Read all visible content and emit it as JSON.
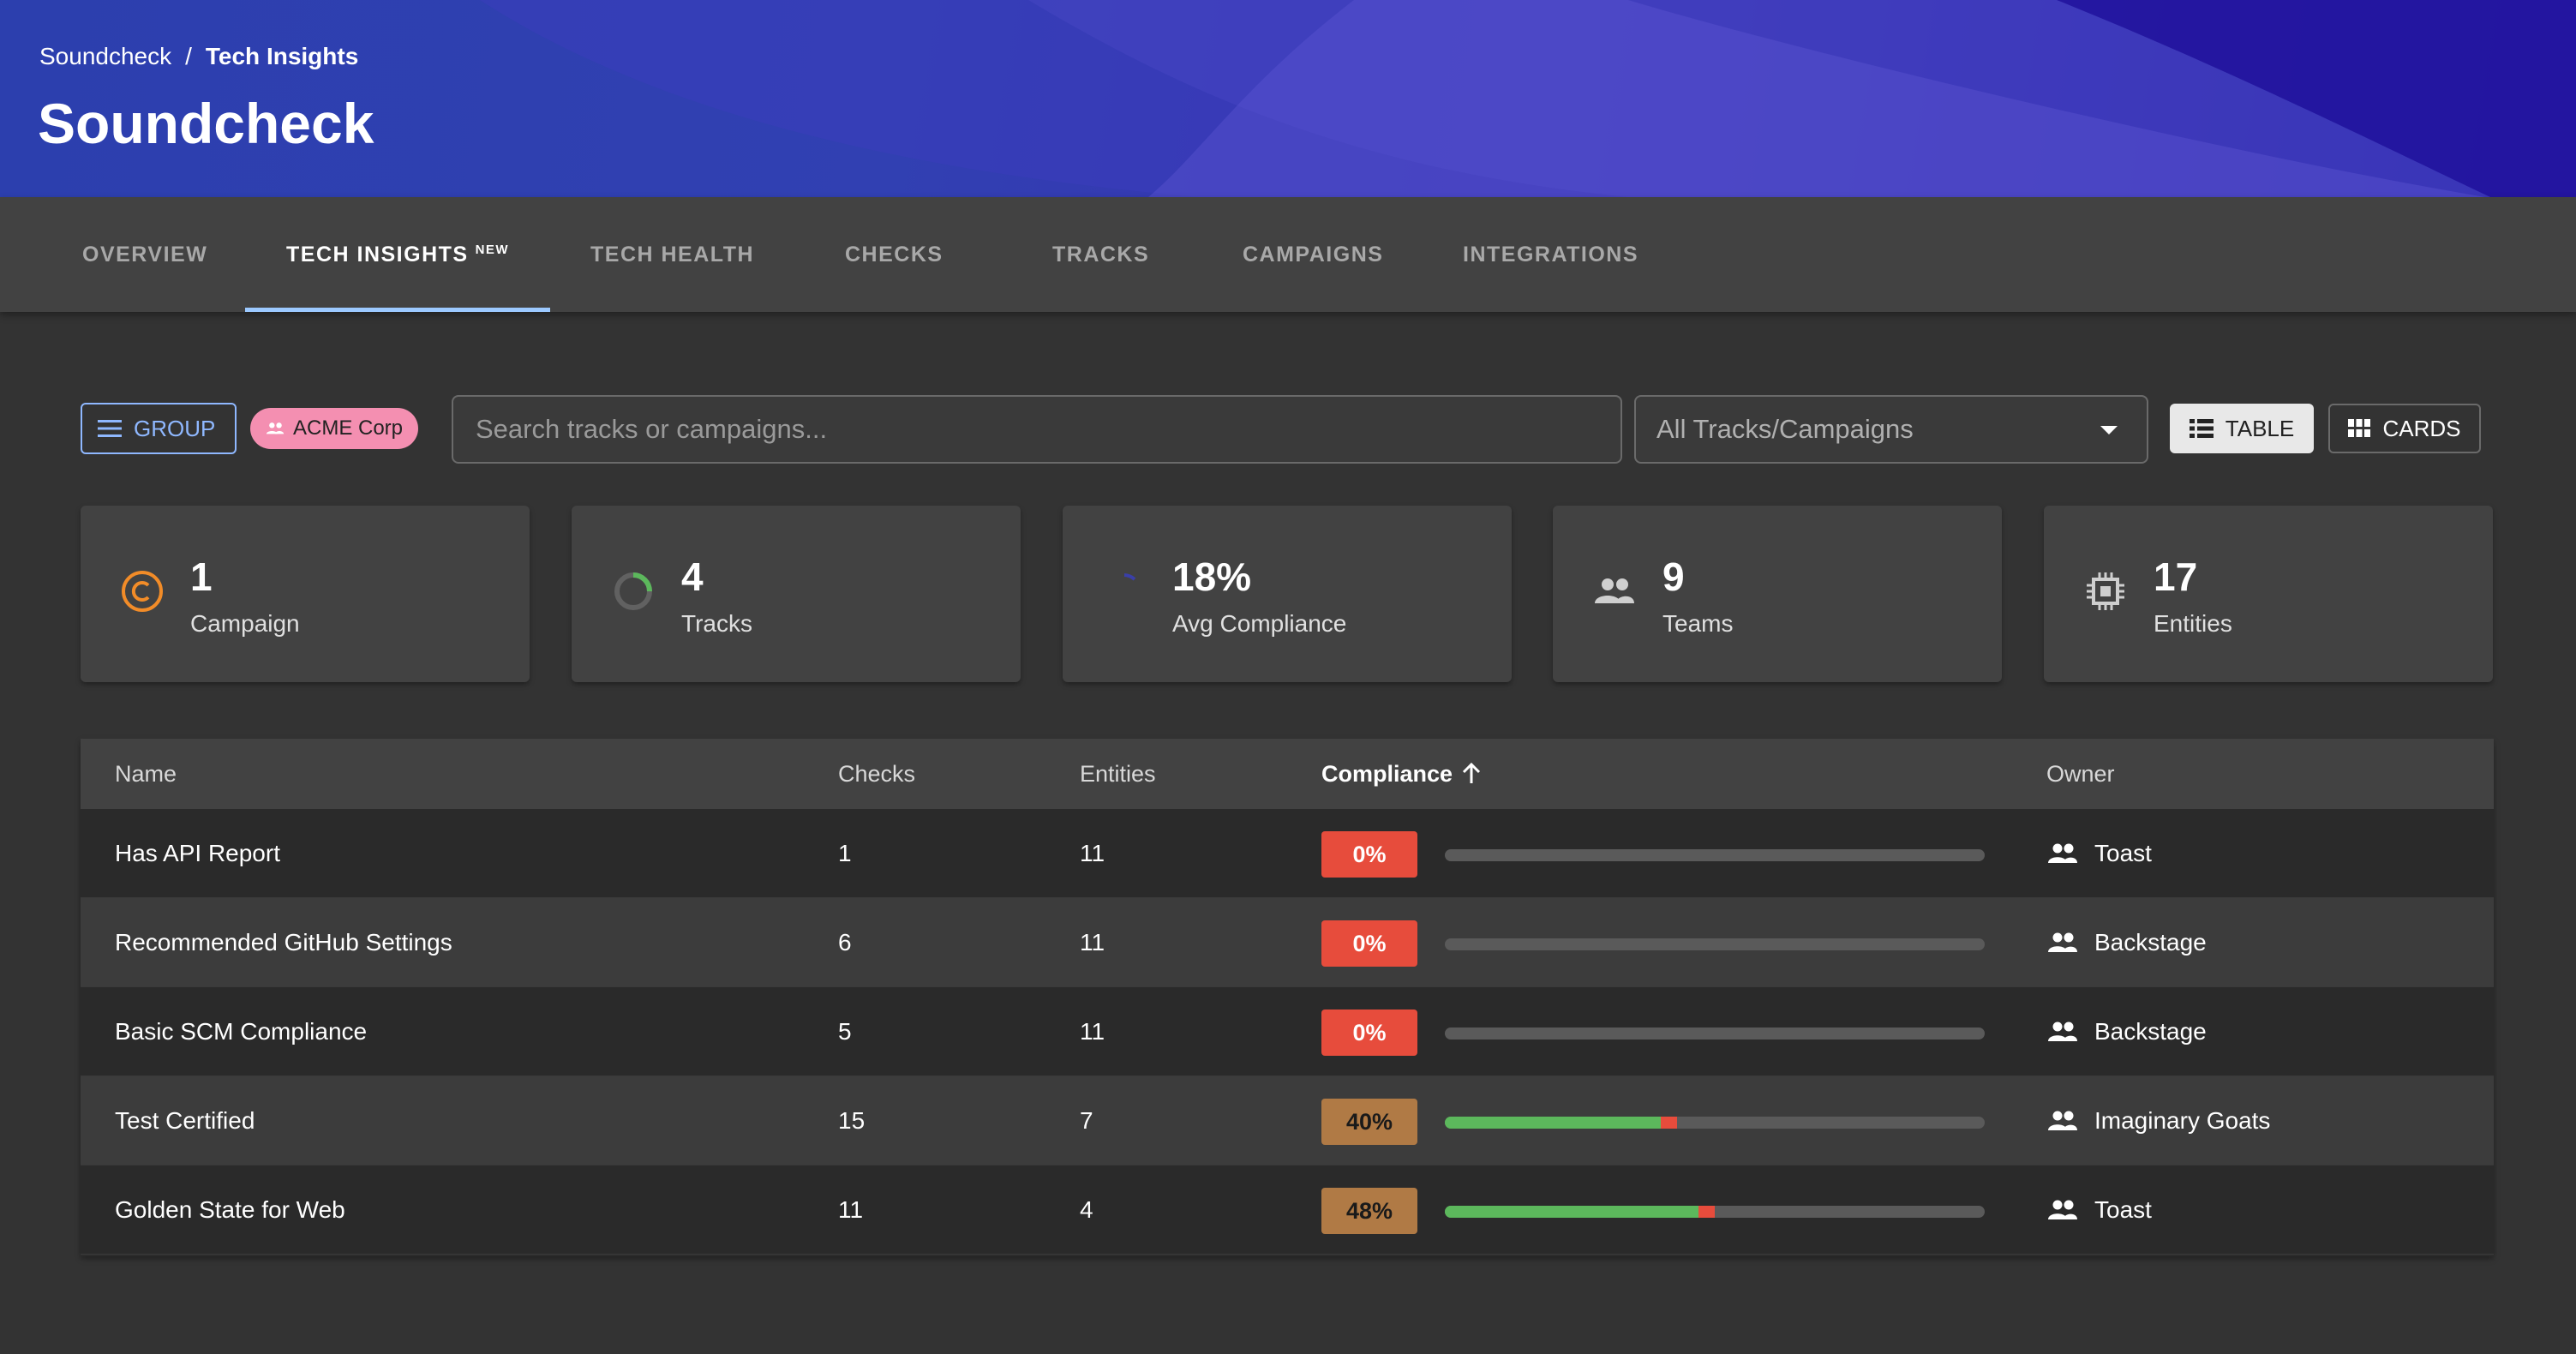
{
  "header": {
    "breadcrumb_root": "Soundcheck",
    "breadcrumb_separator": "/",
    "breadcrumb_current": "Tech Insights",
    "title": "Soundcheck"
  },
  "tabs": [
    {
      "label": "OVERVIEW"
    },
    {
      "label": "TECH INSIGHTS",
      "badge": "NEW",
      "active": true
    },
    {
      "label": "TECH HEALTH"
    },
    {
      "label": "CHECKS"
    },
    {
      "label": "TRACKS"
    },
    {
      "label": "CAMPAIGNS"
    },
    {
      "label": "INTEGRATIONS"
    }
  ],
  "toolbar": {
    "group_label": "GROUP",
    "group_chip": "ACME Corp",
    "search_placeholder": "Search tracks or campaigns...",
    "select_value": "All Tracks/Campaigns",
    "table_label": "TABLE",
    "cards_label": "CARDS"
  },
  "stats": [
    {
      "value": "1",
      "label": "Campaign",
      "icon": "copyright-icon"
    },
    {
      "value": "4",
      "label": "Tracks",
      "icon": "progress-ring-icon"
    },
    {
      "value": "18%",
      "label": "Avg Compliance",
      "icon": "spinner-icon"
    },
    {
      "value": "9",
      "label": "Teams",
      "icon": "people-icon"
    },
    {
      "value": "17",
      "label": "Entities",
      "icon": "chip-icon"
    }
  ],
  "table": {
    "columns": {
      "name": "Name",
      "checks": "Checks",
      "entities": "Entities",
      "compliance": "Compliance",
      "owner": "Owner"
    },
    "rows": [
      {
        "name": "Has API Report",
        "checks": "1",
        "entities": "11",
        "compliance": "0%",
        "pass": 0,
        "fail": 0,
        "owner": "Toast"
      },
      {
        "name": "Recommended GitHub Settings",
        "checks": "6",
        "entities": "11",
        "compliance": "0%",
        "pass": 0,
        "fail": 0,
        "owner": "Backstage"
      },
      {
        "name": "Basic SCM Compliance",
        "checks": "5",
        "entities": "11",
        "compliance": "0%",
        "pass": 0,
        "fail": 0,
        "owner": "Backstage"
      },
      {
        "name": "Test Certified",
        "checks": "15",
        "entities": "7",
        "compliance": "40%",
        "pass": 0.4,
        "fail": 0.03,
        "owner": "Imaginary Goats"
      },
      {
        "name": "Golden State for Web",
        "checks": "11",
        "entities": "4",
        "compliance": "48%",
        "pass": 0.47,
        "fail": 0.03,
        "owner": "Toast"
      }
    ]
  },
  "colors": {
    "badge_zero": "#e74c3c",
    "badge_partial": "#b07a45",
    "pass": "#5cb85c",
    "fail": "#e74c3c",
    "accent": "#8fb8ff",
    "chip": "#f48fb1"
  }
}
